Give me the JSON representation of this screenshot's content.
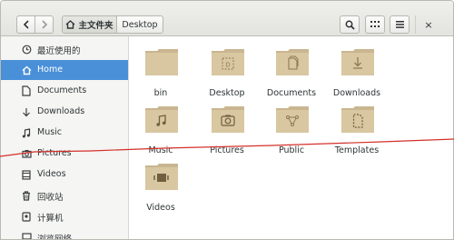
{
  "header": {
    "back_icon": "chevron-left-icon",
    "forward_icon": "chevron-right-icon",
    "breadcrumb": [
      {
        "label": "主文件夹",
        "icon": "home-icon"
      },
      {
        "label": "Desktop"
      }
    ],
    "tools": [
      "search-icon",
      "grid-view-icon",
      "hamburger-menu-icon"
    ],
    "close_glyph": "×"
  },
  "sidebar": {
    "items": [
      {
        "label": "最近使用的",
        "icon": "clock-icon"
      },
      {
        "label": "Home",
        "icon": "home-icon",
        "active": true
      },
      {
        "label": "Documents",
        "icon": "document-icon"
      },
      {
        "label": "Downloads",
        "icon": "download-arrow-icon"
      },
      {
        "label": "Music",
        "icon": "music-note-icon"
      },
      {
        "label": "Pictures",
        "icon": "camera-icon"
      },
      {
        "label": "Videos",
        "icon": "film-icon"
      },
      {
        "label": "回收站",
        "icon": "trash-icon"
      },
      {
        "label": "计算机",
        "icon": "drive-icon"
      },
      {
        "label": "浏览网络",
        "icon": "network-icon"
      }
    ]
  },
  "main": {
    "items": [
      {
        "label": "bin",
        "emblem": "none"
      },
      {
        "label": "Desktop",
        "emblem": "desktop"
      },
      {
        "label": "Documents",
        "emblem": "documents"
      },
      {
        "label": "Downloads",
        "emblem": "downloads"
      },
      {
        "label": "Music",
        "emblem": "music"
      },
      {
        "label": "Pictures",
        "emblem": "pictures"
      },
      {
        "label": "Public",
        "emblem": "public"
      },
      {
        "label": "Templates",
        "emblem": "templates"
      },
      {
        "label": "Videos",
        "emblem": "videos"
      }
    ]
  },
  "colors": {
    "accent": "#4a90d9",
    "folder": "#d8c7a1",
    "folder_dark": "#bfa97c",
    "annotation": "#d4302a"
  }
}
